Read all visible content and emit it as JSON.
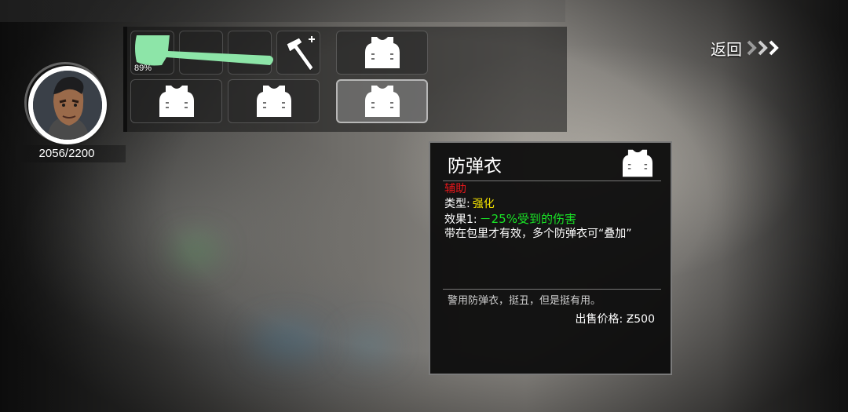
{
  "player": {
    "hp": "2056/2200"
  },
  "inventory": {
    "axe_durability": "89%",
    "icons": {
      "axe": "axe-icon",
      "hammer": "hammer-icon",
      "vest": "vest-icon"
    }
  },
  "nav": {
    "return_label": "返回"
  },
  "tooltip": {
    "title": "防弹衣",
    "category": "辅助",
    "type_label": "类型:",
    "type_value": "强化",
    "effect_label": "效果1:",
    "effect_value": "－25%受到的伤害",
    "description": "带在包里才有效，多个防弹衣可“叠加”",
    "flavor": "警用防弹衣，挺丑，但是挺有用。",
    "price_label": "出售价格:",
    "price_value": "Ƶ500"
  },
  "colors": {
    "category": "#e8171b",
    "type_value": "#f5e300",
    "effect_value": "#19e326",
    "axe": "#8de5a8"
  }
}
